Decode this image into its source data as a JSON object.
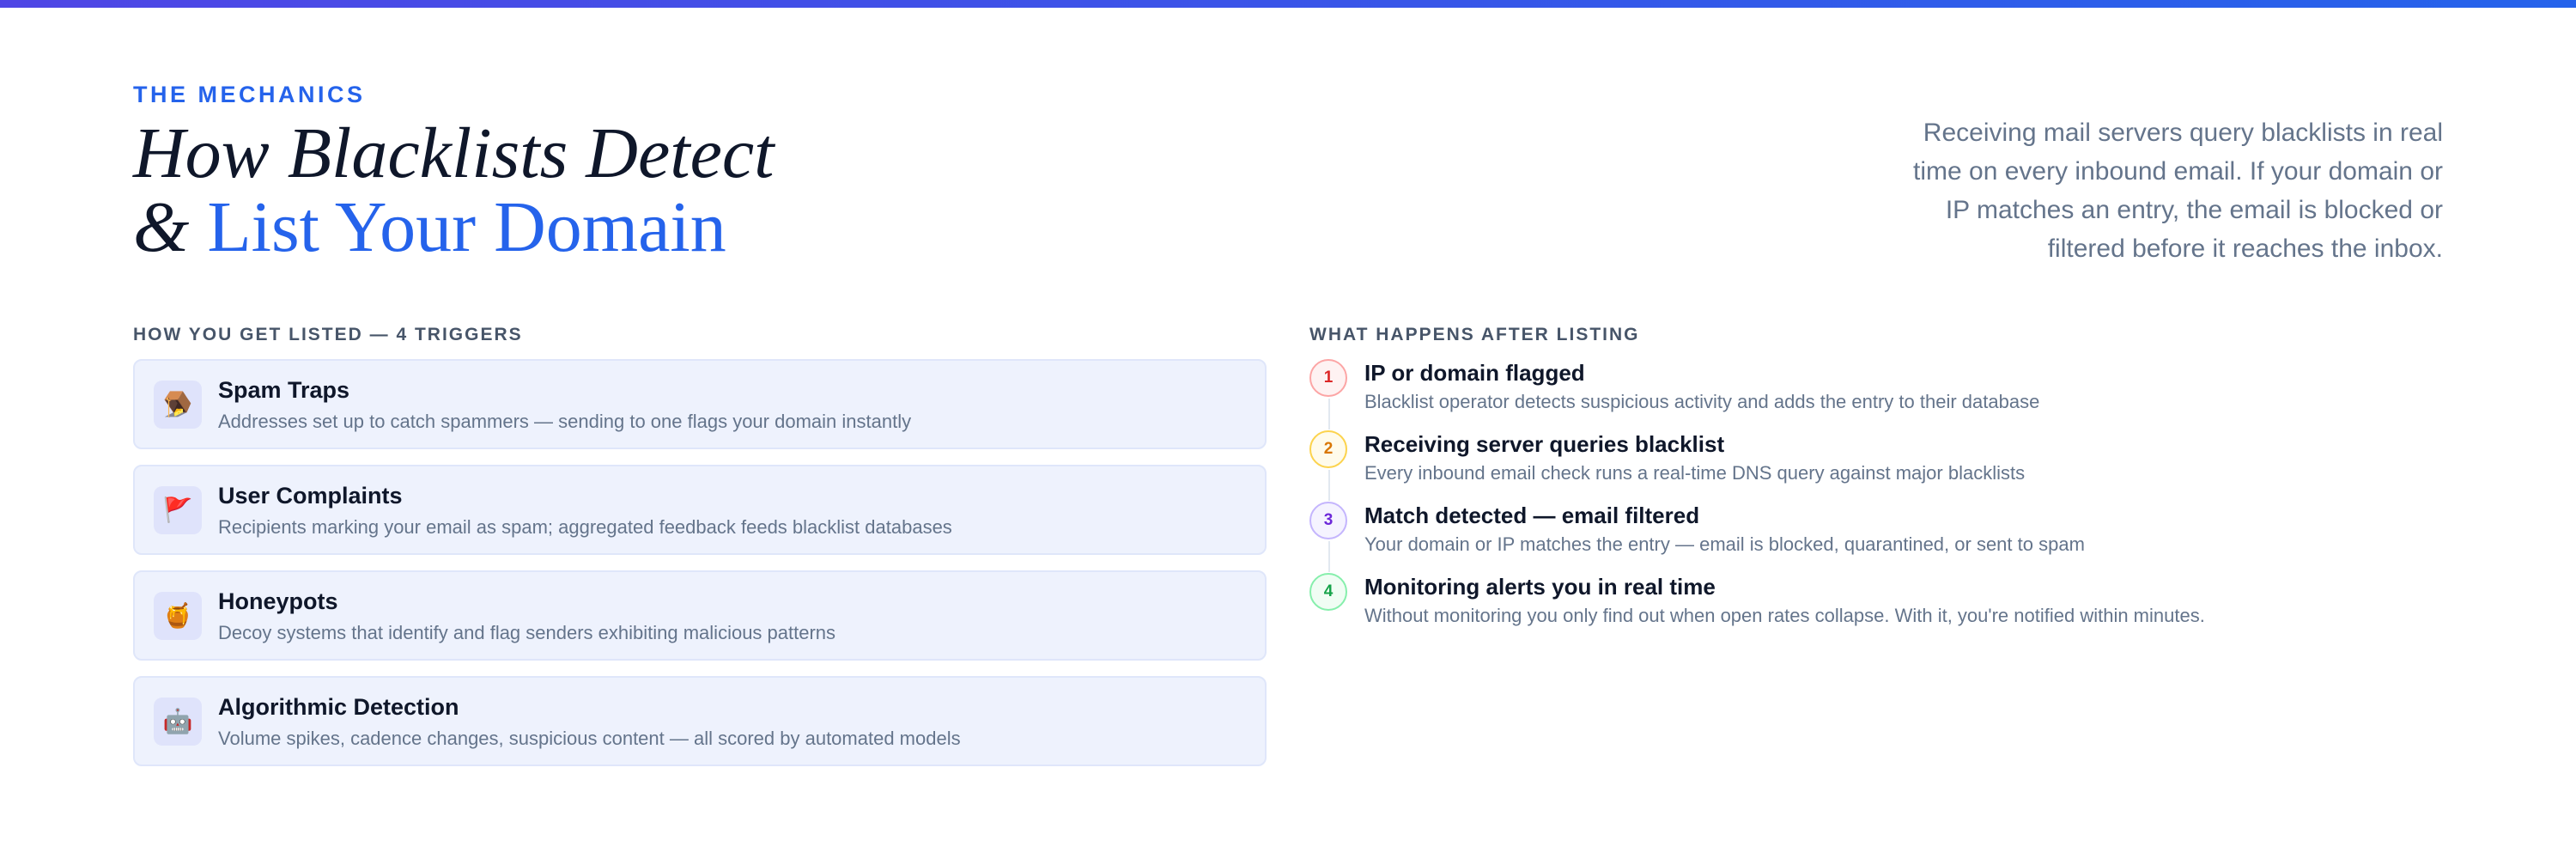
{
  "header": {
    "eyebrow": "THE MECHANICS",
    "title_line1": "How Blacklists Detect",
    "title_amp": "&",
    "title_accent": "List Your Domain",
    "intro": "Receiving mail servers query blacklists in real time on every inbound email. If your domain or IP matches an entry, the email is blocked or filtered before it reaches the inbox."
  },
  "triggers": {
    "label": "HOW YOU GET LISTED — 4 TRIGGERS",
    "items": [
      {
        "icon": "trap-icon",
        "glyph": "🪤",
        "title": "Spam Traps",
        "desc": "Addresses set up to catch spammers — sending to one flags your domain instantly"
      },
      {
        "icon": "flag-icon",
        "glyph": "🚩",
        "title": "User Complaints",
        "desc": "Recipients marking your email as spam; aggregated feedback feeds blacklist databases"
      },
      {
        "icon": "honey-pot-icon",
        "glyph": "🍯",
        "title": "Honeypots",
        "desc": "Decoy systems that identify and flag senders exhibiting malicious patterns"
      },
      {
        "icon": "robot-icon",
        "glyph": "🤖",
        "title": "Algorithmic Detection",
        "desc": "Volume spikes, cadence changes, suspicious content — all scored by automated models"
      }
    ]
  },
  "steps": {
    "label": "WHAT HAPPENS AFTER LISTING",
    "items": [
      {
        "num": "1",
        "color": "#dc2626",
        "title": "IP or domain flagged",
        "desc": "Blacklist operator detects suspicious activity and adds the entry to their database"
      },
      {
        "num": "2",
        "color": "#d97706",
        "title": "Receiving server queries blacklist",
        "desc": "Every inbound email check runs a real-time DNS query against major blacklists"
      },
      {
        "num": "3",
        "color": "#6d28d9",
        "title": "Match detected — email filtered",
        "desc": "Your domain or IP matches the entry — email is blocked, quarantined, or sent to spam"
      },
      {
        "num": "4",
        "color": "#16a34a",
        "title": "Monitoring alerts you in real time",
        "desc": "Without monitoring you only find out when open rates collapse. With it, you're notified within minutes."
      }
    ]
  },
  "colors": {
    "accent": "#2563eb",
    "gradient_start": "#4f46e5",
    "text_dark": "#0f172a",
    "text_muted": "#64748b"
  }
}
